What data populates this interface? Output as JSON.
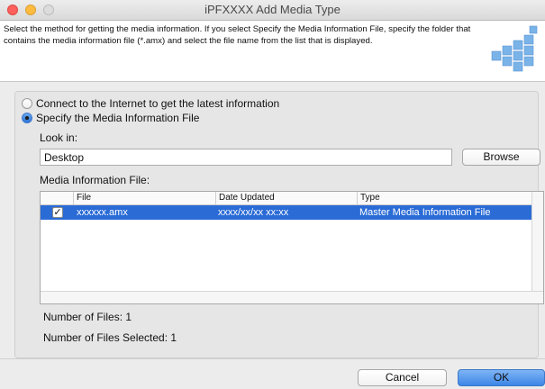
{
  "window": {
    "title": "iPFXXXX Add Media Type"
  },
  "header": {
    "instructions": "Select the method for getting the media information. If you select Specify the Media Information File, specify the folder that contains the media information file (*.amx) and select the file name from the list that is displayed.",
    "graphic_icon": "media-cubes-icon"
  },
  "options": {
    "internet_label": "Connect to the Internet to get the latest information",
    "file_label": "Specify the Media Information File",
    "selected": "file"
  },
  "look_in": {
    "label": "Look in:",
    "value": "Desktop",
    "browse_label": "Browse"
  },
  "media_files": {
    "label": "Media Information File:",
    "columns": [
      "File",
      "Date Updated",
      "Type"
    ],
    "rows": [
      {
        "checked": true,
        "file": "xxxxxx.amx",
        "date": "xxxx/xx/xx xx:xx",
        "type": "Master Media Information File"
      }
    ]
  },
  "stats": {
    "files_count": "Number of Files: 1",
    "selected_count": "Number of Files Selected: 1"
  },
  "buttons": {
    "cancel": "Cancel",
    "ok": "OK"
  },
  "colors": {
    "selection": "#2a6bd6",
    "default_button": "#3c86e6"
  }
}
